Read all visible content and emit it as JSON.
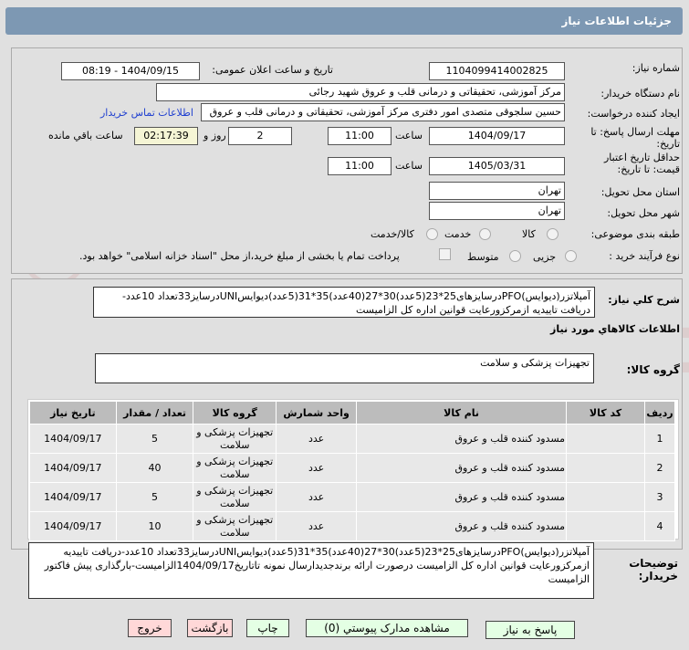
{
  "header": {
    "title": "جزئیات اطلاعات نیاز"
  },
  "form": {
    "need_number_label": "شماره نیاز:",
    "need_number": "1104099414002825",
    "announce_label": "تاریخ و ساعت اعلان عمومی:",
    "announce_value": "1404/09/15 - 08:19",
    "buyer_label": "نام دستگاه خریدار:",
    "buyer": "مرکز آموزشی، تحقیقاتی و درمانی قلب و عروق شهید رجائی",
    "creator_label": "ایجاد کننده درخواست:",
    "creator": "حسین سلجوقی متصدی امور دفتری مرکز آموزشی، تحقیقاتی و درمانی قلب و عروق",
    "contact_link": "اطلاعات تماس خریدار",
    "deadline_label": "مهلت ارسال پاسخ: تا تاریخ:",
    "deadline_date": "1404/09/17",
    "time_label": "ساعت",
    "deadline_time": "11:00",
    "days": "2",
    "days_label": "روز و",
    "remaining": "02:17:39",
    "remaining_label": "ساعت باقي مانده",
    "validity_label": "حداقل تاریخ اعتبار قیمت: تا تاریخ:",
    "validity_date": "1405/03/31",
    "validity_time": "11:00",
    "province_label": "استان محل تحویل:",
    "province": "تهران",
    "city_label": "شهر محل تحویل:",
    "city": "تهران",
    "category_label": "طبقه بندی موضوعی:",
    "cat_options": [
      "کالا",
      "خدمت",
      "کالا/خدمت"
    ],
    "process_label": "نوع فرآیند خرید :",
    "process_options": [
      "جزیی",
      "متوسط"
    ],
    "payment_note": "پرداخت تمام یا بخشی از مبلغ خرید،از محل \"اسناد خزانه اسلامی\" خواهد بود."
  },
  "summary": {
    "label": "شرح کلي نياز:",
    "text": "آمپلاتزر(دیوایس)PFOدرسایزهای25*23(5عدد)30*27(40عدد)35*31(5عدد)دیوایسUNIدرسایز33تعداد 10عدد-دریافت تاییدیه ازمرکزورعایت قوانین اداره کل الزامیست"
  },
  "goods": {
    "section_title": "اطلاعات کالاهاي مورد نياز",
    "group_label": "گروه کالا:",
    "group": "تجهیزات پزشکی و سلامت"
  },
  "table": {
    "headers": [
      "ردیف",
      "کد کالا",
      "نام کالا",
      "واحد شمارش",
      "گروه کالا",
      "تعداد / مقدار",
      "تاریخ نیاز"
    ],
    "rows": [
      [
        "1",
        "",
        "مسدود کننده قلب و عروق",
        "عدد",
        "تجهیزات پزشکی و سلامت",
        "5",
        "1404/09/17"
      ],
      [
        "2",
        "",
        "مسدود کننده قلب و عروق",
        "عدد",
        "تجهیزات پزشکی و سلامت",
        "40",
        "1404/09/17"
      ],
      [
        "3",
        "",
        "مسدود کننده قلب و عروق",
        "عدد",
        "تجهیزات پزشکی و سلامت",
        "5",
        "1404/09/17"
      ],
      [
        "4",
        "",
        "مسدود کننده قلب و عروق",
        "عدد",
        "تجهیزات پزشکی و سلامت",
        "10",
        "1404/09/17"
      ]
    ]
  },
  "notes": {
    "label": "توضیحات خریدار:",
    "text": "آمپلاتزر(دیوایس)PFOدرسایزهای25*23(5عدد)30*27(40عدد)35*31(5عدد)دیوایسUNIدرسایز33تعداد 10عدد-دریافت تاییدیه ازمرکزورعایت قوانین اداره کل الزامیست درصورت ارائه برندجدیدارسال نمونه تاتاریخ1404/09/17الزامیست-بارگذاری پیش فاکتور الزامیست"
  },
  "buttons": {
    "reply": "پاسخ به نیاز",
    "attachments": "مشاهده مدارک پیوستي (0)",
    "print": "چاپ",
    "back": "بازگشت",
    "exit": "خروج"
  }
}
